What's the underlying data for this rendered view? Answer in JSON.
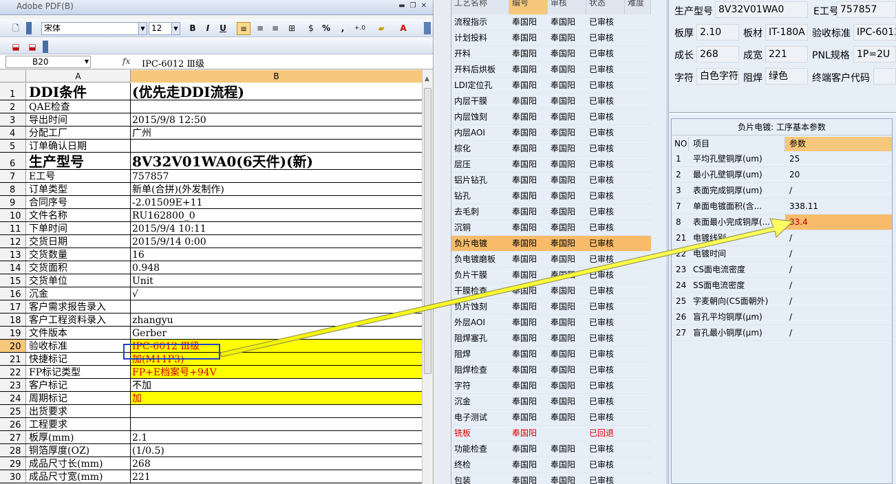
{
  "excel": {
    "title": "Adobe PDF(B)",
    "font_name": "宋体",
    "font_size": "12",
    "name_box": "B20",
    "fx_label": "fx",
    "formula_value": "IPC-6012 Ⅲ级",
    "columns": [
      "A",
      "B"
    ],
    "toolbar": {
      "bold": "B",
      "italic": "I",
      "underline": "U",
      "percent": "%",
      "comma": ",",
      "decimals": "+.0 .00"
    },
    "rows": [
      {
        "n": "1",
        "a": "DDI条件",
        "b": "(优先走DDI流程)",
        "big": true
      },
      {
        "n": "2",
        "a": "QAE检查",
        "b": ""
      },
      {
        "n": "3",
        "a": "导出时间",
        "b": "2015/9/8 12:50"
      },
      {
        "n": "4",
        "a": "分配工厂",
        "b": "广州"
      },
      {
        "n": "5",
        "a": "订单确认日期",
        "b": ""
      },
      {
        "n": "6",
        "a": "生产型号",
        "b": "8V32V01WA0(6天件)(新)",
        "big": true
      },
      {
        "n": "7",
        "a": "E工号",
        "b": "757857"
      },
      {
        "n": "8",
        "a": "订单类型",
        "b": "新单(合拼)(外发制作)"
      },
      {
        "n": "9",
        "a": "合同序号",
        "b": "-2.01509E+11"
      },
      {
        "n": "10",
        "a": "文件名称",
        "b": "RU162800_0"
      },
      {
        "n": "11",
        "a": "下单时间",
        "b": "2015/9/4 10:11"
      },
      {
        "n": "12",
        "a": "交货日期",
        "b": "2015/9/14 0:00"
      },
      {
        "n": "13",
        "a": "交货数量",
        "b": "16"
      },
      {
        "n": "14",
        "a": "交货面积",
        "b": "0.948"
      },
      {
        "n": "15",
        "a": "交货单位",
        "b": "Unit"
      },
      {
        "n": "16",
        "a": "沉金",
        "b": "√"
      },
      {
        "n": "17",
        "a": "客户需求报告录入",
        "b": ""
      },
      {
        "n": "18",
        "a": "客户工程资料录入",
        "b": "zhangyu"
      },
      {
        "n": "19",
        "a": "文件版本",
        "b": "Gerber"
      },
      {
        "n": "20",
        "a": "验收标准",
        "b": "IPC-6012 Ⅲ级",
        "hl": true,
        "sel": true
      },
      {
        "n": "21",
        "a": "快捷标记",
        "b": "加(M11P3)",
        "hl": true
      },
      {
        "n": "22",
        "a": "FP标记类型",
        "b": "FP+E档案号+94V",
        "hl": true
      },
      {
        "n": "23",
        "a": "客户标记",
        "b": "不加"
      },
      {
        "n": "24",
        "a": "周期标记",
        "b": "加",
        "hl": true
      },
      {
        "n": "25",
        "a": "出货要求",
        "b": ""
      },
      {
        "n": "26",
        "a": "工程要求",
        "b": ""
      },
      {
        "n": "27",
        "a": "板厚(mm)",
        "b": "2.1"
      },
      {
        "n": "28",
        "a": "铜箔厚度(OZ)",
        "b": "(1/0.5)"
      },
      {
        "n": "29",
        "a": "成品尺寸长(mm)",
        "b": "268"
      },
      {
        "n": "30",
        "a": "成品尺寸宽(mm)",
        "b": "221"
      }
    ]
  },
  "process": {
    "headers": [
      "工艺名称",
      "编号",
      "审核",
      "状态",
      "难度"
    ],
    "rows": [
      {
        "name": "流程指示",
        "code": "奉国阳",
        "review": "奉国阳",
        "status": "已审核"
      },
      {
        "name": "计划投料",
        "code": "奉国阳",
        "review": "奉国阳",
        "status": "已审核"
      },
      {
        "name": "开料",
        "code": "奉国阳",
        "review": "奉国阳",
        "status": "已审核"
      },
      {
        "name": "开料后烘板",
        "code": "奉国阳",
        "review": "奉国阳",
        "status": "已审核"
      },
      {
        "name": "LDI定位孔",
        "code": "奉国阳",
        "review": "奉国阳",
        "status": "已审核"
      },
      {
        "name": "内层干膜",
        "code": "奉国阳",
        "review": "奉国阳",
        "status": "已审核"
      },
      {
        "name": "内层蚀刻",
        "code": "奉国阳",
        "review": "奉国阳",
        "status": "已审核"
      },
      {
        "name": "内层AOI",
        "code": "奉国阳",
        "review": "奉国阳",
        "status": "已审核"
      },
      {
        "name": "棕化",
        "code": "奉国阳",
        "review": "奉国阳",
        "status": "已审核"
      },
      {
        "name": "层压",
        "code": "奉国阳",
        "review": "奉国阳",
        "status": "已审核"
      },
      {
        "name": "铝片钻孔",
        "code": "奉国阳",
        "review": "奉国阳",
        "status": "已审核"
      },
      {
        "name": "钻孔",
        "code": "奉国阳",
        "review": "奉国阳",
        "status": "已审核"
      },
      {
        "name": "去毛刺",
        "code": "奉国阳",
        "review": "奉国阳",
        "status": "已审核"
      },
      {
        "name": "沉铜",
        "code": "奉国阳",
        "review": "奉国阳",
        "status": "已审核"
      },
      {
        "name": "负片电镀",
        "code": "奉国阳",
        "review": "奉国阳",
        "status": "已审核",
        "sel": true
      },
      {
        "name": "负电镀磨板",
        "code": "奉国阳",
        "review": "奉国阳",
        "status": "已审核"
      },
      {
        "name": "负片干膜",
        "code": "奉国阳",
        "review": "奉国阳",
        "status": "已审核"
      },
      {
        "name": "干膜检查",
        "code": "奉国阳",
        "review": "奉国阳",
        "status": "已审核"
      },
      {
        "name": "负片蚀刻",
        "code": "奉国阳",
        "review": "奉国阳",
        "status": "已审核"
      },
      {
        "name": "外层AOI",
        "code": "奉国阳",
        "review": "奉国阳",
        "status": "已审核"
      },
      {
        "name": "阻焊塞孔",
        "code": "奉国阳",
        "review": "奉国阳",
        "status": "已审核"
      },
      {
        "name": "阻焊",
        "code": "奉国阳",
        "review": "奉国阳",
        "status": "已审核"
      },
      {
        "name": "阻焊检查",
        "code": "奉国阳",
        "review": "奉国阳",
        "status": "已审核"
      },
      {
        "name": "字符",
        "code": "奉国阳",
        "review": "奉国阳",
        "status": "已审核"
      },
      {
        "name": "沉金",
        "code": "奉国阳",
        "review": "奉国阳",
        "status": "已审核"
      },
      {
        "name": "电子测试",
        "code": "奉国阳",
        "review": "奉国阳",
        "status": "已审核"
      },
      {
        "name": "铣板",
        "code": "奉国阳",
        "review": "",
        "status": "已回退",
        "red": true
      },
      {
        "name": "功能检查",
        "code": "奉国阳",
        "review": "奉国阳",
        "status": "已审核"
      },
      {
        "name": "终检",
        "code": "奉国阳",
        "review": "奉国阳",
        "status": "已审核"
      },
      {
        "name": "包装",
        "code": "奉国阳",
        "review": "奉国阳",
        "status": "已审核"
      }
    ]
  },
  "info": {
    "model_label": "生产型号",
    "model_value": "8V32V01WA0",
    "e_label": "E工号",
    "e_value": "757857",
    "thickness_label": "板厚",
    "thickness_value": "2.10",
    "material_label": "板材",
    "material_value": "IT-180A",
    "standard_label": "验收标准",
    "standard_value": "IPC-6012",
    "length_label": "成长",
    "length_value": "268",
    "width_label": "成宽",
    "width_value": "221",
    "pnl_label": "PNL规格",
    "pnl_value": "1P=2U",
    "char_label": "字符",
    "char_value": "白色字符",
    "mask_label": "阻焊",
    "mask_value": "绿色",
    "customer_label": "终端客户代码",
    "customer_value": ""
  },
  "params": {
    "title": "负片电镀: 工序基本参数",
    "headers": [
      "NO",
      "项目",
      "参数"
    ],
    "rows": [
      {
        "no": "1",
        "item": "平均孔壁铜厚(um)",
        "value": "25"
      },
      {
        "no": "2",
        "item": "最小孔壁铜厚(um)",
        "value": "20"
      },
      {
        "no": "3",
        "item": "表面完成铜厚(um)",
        "value": "/"
      },
      {
        "no": "7",
        "item": "单面电镀面积(含...",
        "value": "338.11"
      },
      {
        "no": "8",
        "item": "表面最小完成铜厚(...",
        "value": "33.4",
        "sel": true
      },
      {
        "no": "21",
        "item": "电镀线别",
        "value": "/"
      },
      {
        "no": "22",
        "item": "电镀时间",
        "value": "/"
      },
      {
        "no": "23",
        "item": "CS面电流密度",
        "value": "/"
      },
      {
        "no": "24",
        "item": "SS面电流密度",
        "value": "/"
      },
      {
        "no": "25",
        "item": "字麦朝向(CS面朝外)",
        "value": "/"
      },
      {
        "no": "26",
        "item": "盲孔平均铜厚(μm)",
        "value": "/"
      },
      {
        "no": "27",
        "item": "盲孔最小铜厚(μm)",
        "value": "/"
      }
    ]
  },
  "colors": {
    "highlight": "#ffff00",
    "highlight_text": "#d00000",
    "selection": "#f7bb6a",
    "arrow": "#ffff33",
    "selection_box": "#1f3fd0"
  }
}
